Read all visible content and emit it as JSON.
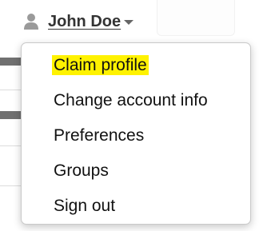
{
  "user_menu": {
    "user_name": "John Doe",
    "user_icon": "user-icon",
    "caret_icon": "caret-down-icon",
    "highlight_color": "#fff200",
    "items": [
      {
        "label": "Claim profile",
        "highlighted": true
      },
      {
        "label": "Change account info",
        "highlighted": false
      },
      {
        "label": "Preferences",
        "highlighted": false
      },
      {
        "label": "Groups",
        "highlighted": false
      },
      {
        "label": "Sign out",
        "highlighted": false
      }
    ]
  }
}
